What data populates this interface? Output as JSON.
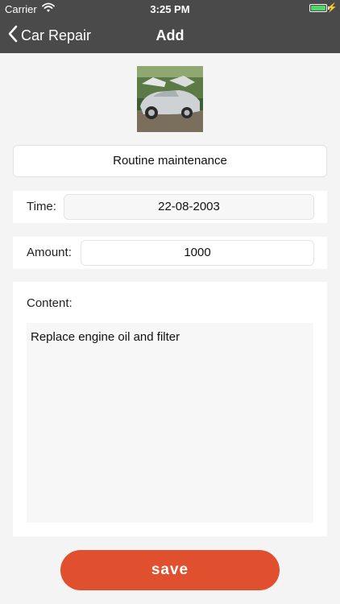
{
  "status_bar": {
    "carrier": "Carrier",
    "time": "3:25 PM",
    "battery_level": 1.0,
    "icons": [
      "wifi-icon",
      "battery-icon",
      "charging-bolt-icon"
    ]
  },
  "nav": {
    "back_label": "Car Repair",
    "back_icon": "chevron-left-icon",
    "title": "Add"
  },
  "form": {
    "photo_icon": "car-photo",
    "title_value": "Routine maintenance",
    "time_label": "Time:",
    "time_value": "22-08-2003",
    "amount_label": "Amount:",
    "amount_value": "1000",
    "content_label": "Content:",
    "content_value": "Replace engine oil and filter"
  },
  "actions": {
    "save_label": "save"
  },
  "colors": {
    "nav_background": "#4a4a4a",
    "save_button": "#e0502e",
    "battery": "#4cd964"
  }
}
